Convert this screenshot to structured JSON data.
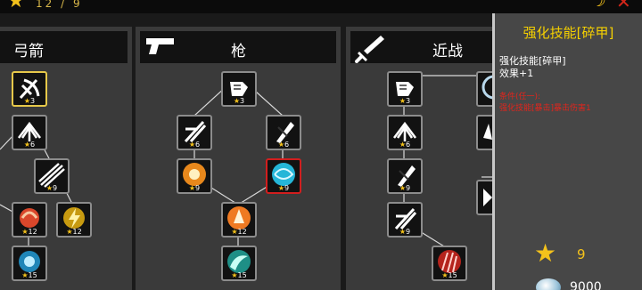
{
  "topbar": {
    "star_count": "12 / 9"
  },
  "columns": [
    {
      "key": "bow",
      "title": "弓箭"
    },
    {
      "key": "gun",
      "title": "枪"
    },
    {
      "key": "melee",
      "title": "近战"
    }
  ],
  "skills": [
    {
      "level": "3",
      "icon": "bow-arrow-icon",
      "color": "#ffffff"
    },
    {
      "level": "6",
      "icon": "multi-arrow-icon",
      "color": "#ffffff"
    },
    {
      "level": "9",
      "icon": "triple-arrow-icon",
      "color": "#ffffff"
    },
    {
      "level": "12",
      "icon": "red-burst-icon",
      "color": "#d9472b"
    },
    {
      "level": "12",
      "icon": "yellow-lightning-icon",
      "color": "#f4c21b"
    },
    {
      "level": "15",
      "icon": "cyan-orb-icon",
      "color": "#2fb4e8"
    },
    {
      "level": "3",
      "icon": "fist-icon",
      "color": "#ffffff"
    },
    {
      "level": "6",
      "icon": "slash-icon",
      "color": "#ffffff"
    },
    {
      "level": "6",
      "icon": "blade-icon",
      "color": "#ffffff"
    },
    {
      "level": "9",
      "icon": "orange-orb-icon",
      "color": "#e8881c"
    },
    {
      "level": "9",
      "icon": "cyan-vortex-icon",
      "color": "#25b6d8"
    },
    {
      "level": "12",
      "icon": "fire-burst-icon",
      "color": "#ef7a22"
    },
    {
      "level": "15",
      "icon": "teal-wing-icon",
      "color": "#2bc1a9"
    },
    {
      "level": "3",
      "icon": "fist-icon",
      "color": "#ffffff"
    },
    {
      "level": "6",
      "icon": "multi-arrow-icon",
      "color": "#ffffff"
    },
    {
      "level": "9",
      "icon": "blade-icon",
      "color": "#ffffff"
    },
    {
      "level": "9",
      "icon": "slash-icon",
      "color": "#ffffff"
    },
    {
      "level": "15",
      "icon": "red-claw-icon",
      "color": "#d9342a"
    },
    {
      "level": "",
      "icon": "partial-orb-icon",
      "color": "#b8d8ec"
    },
    {
      "level": "",
      "icon": "partial-shard-icon",
      "color": "#ffffff"
    },
    {
      "level": "",
      "icon": "partial-wing-icon",
      "color": "#ffffff"
    }
  ],
  "panel": {
    "title": "强化技能[碎甲]",
    "skill_name": "强化技能[碎甲]",
    "effect": "效果+1",
    "condition_title": "条件(任一):",
    "condition_text": "强化技能[暴击]暴击伤害1",
    "star_value": "9",
    "gem_value": "9000"
  },
  "colors": {
    "accent_gold": "#f4c21b",
    "title_yellow": "#f5d000",
    "condition_red": "#e0251c",
    "selected_red": "#d21e1e",
    "selected_gold": "#e6c84a"
  }
}
